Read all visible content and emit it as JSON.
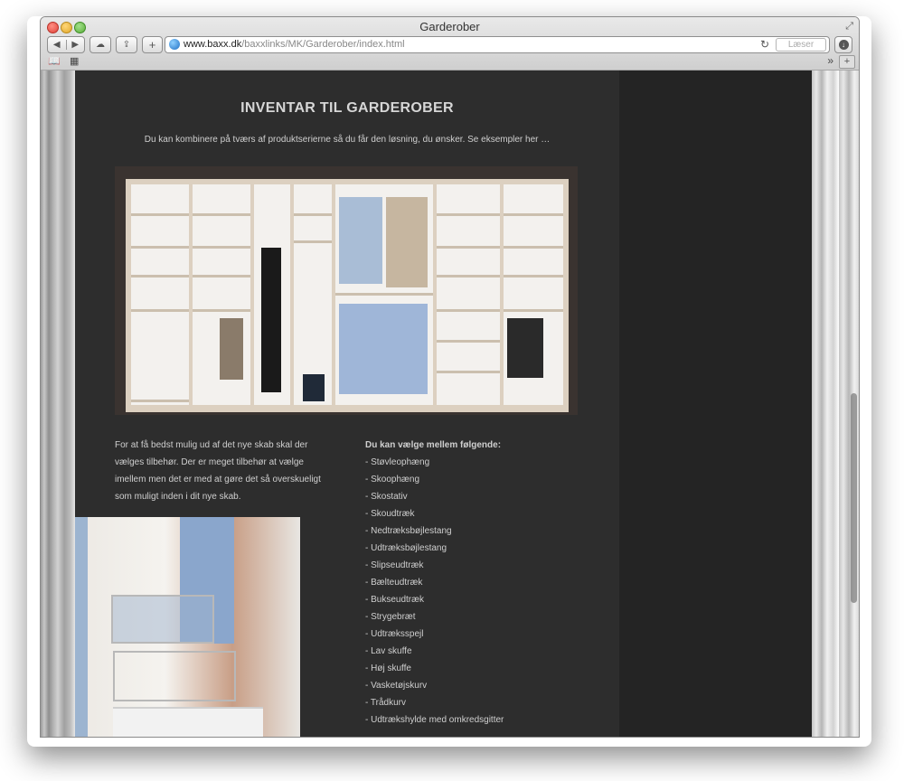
{
  "window": {
    "title": "Garderober"
  },
  "toolbar": {
    "url_domain": "www.baxx.dk",
    "url_path": "/baxxlinks/MK/Garderober/index.html",
    "reader_label": "Læser",
    "icons": [
      "back-icon",
      "forward-icon",
      "cloud-icon",
      "share-icon",
      "add-icon",
      "globe-icon",
      "reload-icon",
      "download-icon",
      "bookmarks-icon",
      "top-sites-icon",
      "more-icon",
      "new-tab-icon"
    ]
  },
  "page": {
    "title": "INVENTAR TIL GARDEROBER",
    "intro": "Du kan kombinere på tværs af produktserierne så du får den løsning, du ønsker. Se eksempler her …",
    "left_text": "For at få bedst mulig ud af det nye skab skal der vælges tilbehør. Der er meget tilbehør at vælge imellem men det er med at gøre det så overskueligt som muligt inden i dit nye skab.",
    "list_heading": "Du kan vælge mellem følgende:",
    "list_items": [
      "- Støvleophæng",
      "- Skoophæng",
      "- Skostativ",
      "- Skoudtræk",
      "- Nedtræksbøjlestang",
      "- Udtræksbøjlestang",
      "- Slipseudtræk",
      "- Bælteudtræk",
      "- Bukseudtræk",
      "- Strygebræt",
      "- Udtræksspejl",
      "- Lav skuffe",
      "- Høj skuffe",
      "- Vasketøjskurv",
      "- Trådkurv",
      "- Udtrækshylde med omkredsgitter"
    ]
  },
  "colors": {
    "content_bg": "#2d2d2d",
    "sidebar_bg": "#242424",
    "text": "#cfcfcf"
  }
}
